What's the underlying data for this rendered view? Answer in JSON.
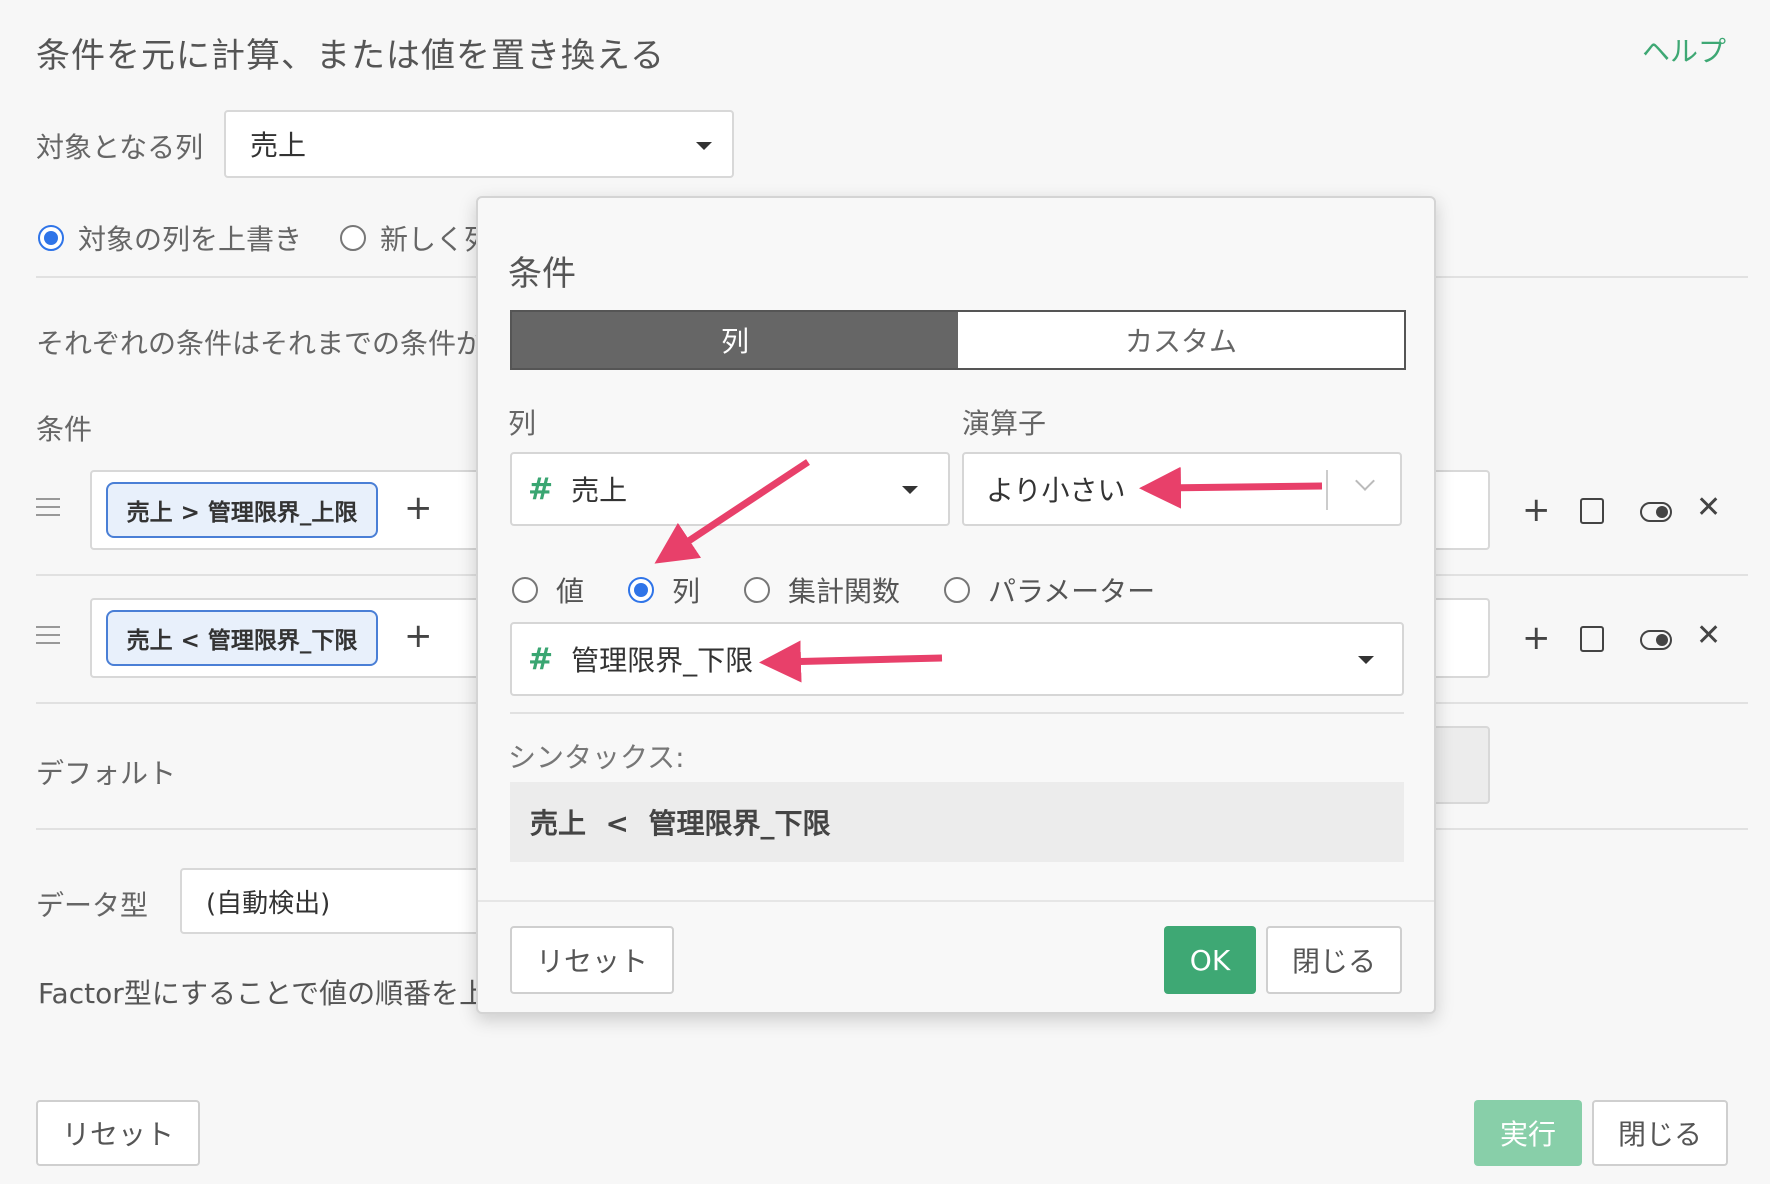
{
  "header": {
    "title": "条件を元に計算、または値を置き換える",
    "help": "ヘルプ"
  },
  "target": {
    "label": "対象となる列",
    "value": "売上"
  },
  "mode": {
    "overwrite": "対象の列を上書き",
    "new_column": "新しく列"
  },
  "description": "それぞれの条件はそれまでの条件が",
  "conditions": {
    "label": "条件",
    "rows": [
      {
        "chip": "売上 > 管理限界_上限"
      },
      {
        "chip": "売上 < 管理限界_下限"
      }
    ]
  },
  "default_label": "デフォルト",
  "data_type": {
    "label": "データ型",
    "value": "(自動検出)"
  },
  "factor_note": "Factor型にすることで値の順番を上",
  "footer": {
    "reset": "リセット",
    "run": "実行",
    "close": "閉じる"
  },
  "modal": {
    "title": "条件",
    "tabs": {
      "column": "列",
      "custom": "カスタム"
    },
    "column_label": "列",
    "operator_label": "演算子",
    "column_value": "売上",
    "operator_value": "より小さい",
    "value_types": [
      "値",
      "列",
      "集計関数",
      "パラメーター"
    ],
    "compare_column": "管理限界_下限",
    "syntax_label": "シンタックス:",
    "syntax": "売上  <  管理限界_下限",
    "reset": "リセット",
    "ok": "OK",
    "close": "閉じる"
  },
  "colors": {
    "accent": "#3ea874",
    "radio": "#2f74e8",
    "arrow": "#e8406a"
  }
}
